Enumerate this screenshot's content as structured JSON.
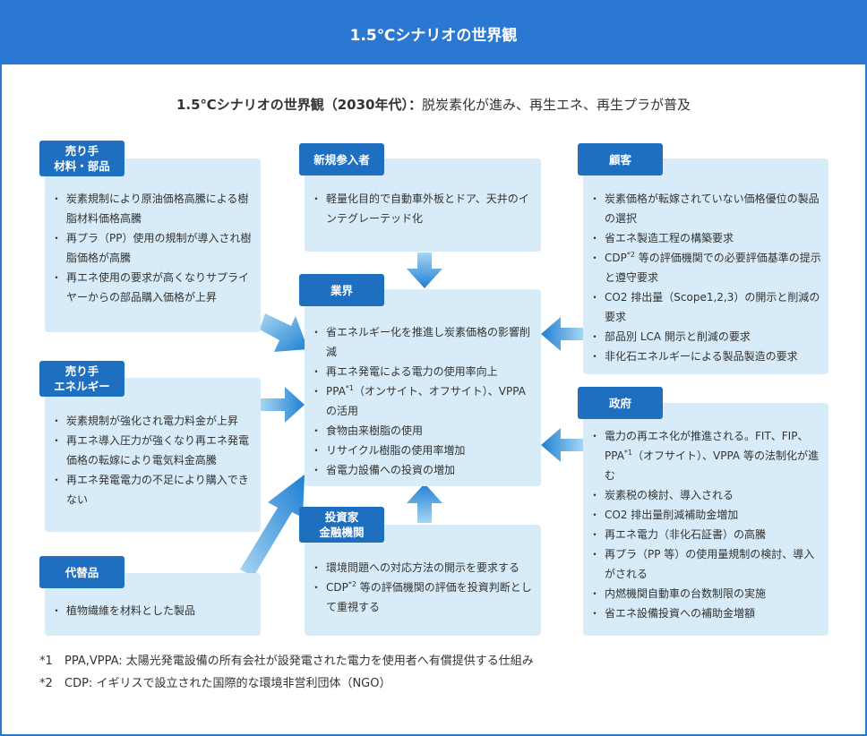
{
  "header": {
    "title": "1.5℃シナリオの世界観"
  },
  "subtitle": {
    "lead": "1.5℃シナリオの世界観（2030年代）：",
    "rest": "脱炭素化が進み、再生エネ、再生プラが普及"
  },
  "sellers_materials": {
    "label_line1": "売り手",
    "label_line2": "材料・部品",
    "items": [
      "炭素規制により原油価格高騰による樹脂材料価格高騰",
      "再プラ（PP）使用の規制が導入され樹脂価格が高騰",
      "再エネ使用の要求が高くなりサプライヤーからの部品購入価格が上昇"
    ]
  },
  "new_entrants": {
    "label": "新規参入者",
    "items": [
      "軽量化目的で自動車外板とドア、天井のインテグレーテッド化"
    ]
  },
  "customers": {
    "label": "顧客",
    "items": [
      "炭素価格が転嫁されていない価格優位の製品の選択",
      "省エネ製造工程の構築要求",
      "CDP",
      "CO2 排出量（Scope1,2,3）の開示と削減の要求",
      "部品別 LCA 開示と削減の要求",
      "非化石エネルギーによる製品製造の要求"
    ],
    "cdp_sup": "*2",
    "cdp_rest": " 等の評価機関での必要評価基準の提示と遵守要求"
  },
  "industry": {
    "label": "業界",
    "items": [
      "省エネルギー化を推進し炭素価格の影響削減",
      "再エネ発電による電力の使用率向上",
      "PPA",
      "食物由来樹脂の使用",
      "リサイクル樹脂の使用率増加",
      "省電力設備への投資の増加"
    ],
    "ppa_sup": "*1",
    "ppa_rest": "（オンサイト、オフサイト）、VPPA の活用"
  },
  "sellers_energy": {
    "label_line1": "売り手",
    "label_line2": "エネルギー",
    "items": [
      "炭素規制が強化され電力料金が上昇",
      "再エネ導入圧力が強くなり再エネ発電価格の転嫁により電気料金高騰",
      "再エネ発電電力の不足により購入できない"
    ]
  },
  "government": {
    "label": "政府",
    "items": [
      "電力の再エネ化が推進される。FIT、FIP、PPA",
      "炭素税の検討、導入される",
      "CO2 排出量削減補助金増加",
      "再エネ電力（非化石証書）の高騰",
      "再プラ（PP 等）の使用量規制の検討、導入がされる",
      "内燃機関自動車の台数制限の実施",
      "省エネ設備投資への補助金増額"
    ],
    "ppa_sup": "*1",
    "ppa_rest": "（オフサイト）、VPPA 等の法制化が進む"
  },
  "investors": {
    "label_line1": "投資家",
    "label_line2": "金融機関",
    "items": [
      "環境問題への対応方法の開示を要求する",
      "CDP"
    ],
    "cdp_sup": "*2",
    "cdp_rest": " 等の評価機関の評価を投資判断として重視する"
  },
  "substitutes": {
    "label": "代替品",
    "items": [
      "植物繊維を材料とした製品"
    ]
  },
  "notes": [
    {
      "mark": "*1",
      "text": "PPA,VPPA: 太陽光発電設備の所有会社が設発電された電力を使用者へ有償提供する仕組み"
    },
    {
      "mark": "*2",
      "text": "CDP: イギリスで設立された国際的な環境非営利団体（NGO）"
    }
  ],
  "colors": {
    "frame": "#2a78d2",
    "label": "#1f6fc1",
    "box": "#d7ecf8",
    "arrow_dark": "#1f7fd2",
    "arrow_light": "#a6d6f3"
  }
}
